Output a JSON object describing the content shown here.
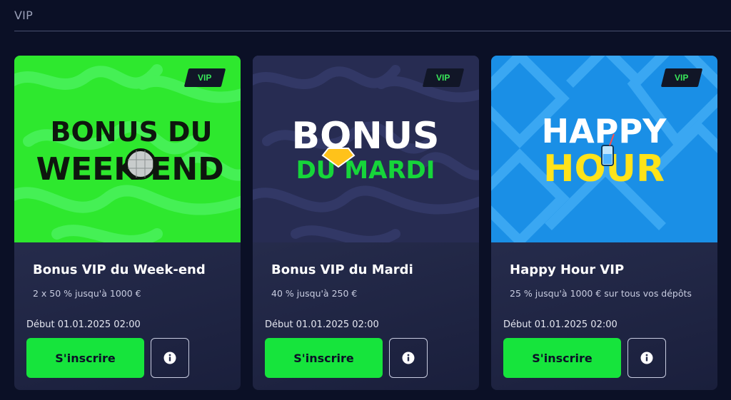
{
  "section": {
    "title": "VIP"
  },
  "colors": {
    "page_bg": "#0b1026",
    "accent_green": "#16e43c",
    "badge_text": "#39e75a"
  },
  "cards": [
    {
      "badge": "VIP",
      "banner_color": "#2ee82e",
      "logo_lines": [
        "BONUS DU",
        "WEEK",
        "END"
      ],
      "title": "Bonus VIP du Week-end",
      "description": "2 x 50 % jusqu'à 1000 €",
      "start": "Début 01.01.2025 02:00",
      "signup_label": "S'inscrire",
      "info_icon": "info-icon"
    },
    {
      "badge": "VIP",
      "banner_color": "#272c52",
      "logo_lines": [
        "BONUS",
        "DU MARDI"
      ],
      "title": "Bonus VIP du Mardi",
      "description": "40 % jusqu'à 250 €",
      "start": "Début 01.01.2025 02:00",
      "signup_label": "S'inscrire",
      "info_icon": "info-icon"
    },
    {
      "badge": "VIP",
      "banner_color": "#1a8fe6",
      "logo_lines": [
        "HAPPY",
        "HOUR"
      ],
      "title": "Happy Hour VIP",
      "description": "25 % jusqu'à 1000 € sur tous vos dépôts",
      "start": "Début 01.01.2025 02:00",
      "signup_label": "S'inscrire",
      "info_icon": "info-icon"
    }
  ]
}
